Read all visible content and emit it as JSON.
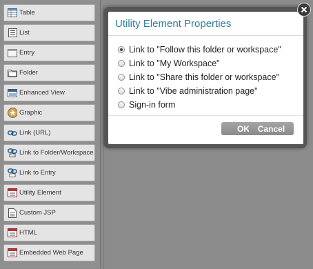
{
  "palette": {
    "items": [
      {
        "label": "Table",
        "icon": "table-icon"
      },
      {
        "label": "List",
        "icon": "list-icon"
      },
      {
        "label": "Entry",
        "icon": "entry-icon"
      },
      {
        "label": "Folder",
        "icon": "folder-icon"
      },
      {
        "label": "Enhanced View",
        "icon": "enhanced-view-icon"
      },
      {
        "label": "Graphic",
        "icon": "graphic-icon"
      },
      {
        "label": "Link (URL)",
        "icon": "link-icon"
      },
      {
        "label": "Link to Folder/Workspace",
        "icon": "link-icon"
      },
      {
        "label": "Link to Entry",
        "icon": "link-icon"
      },
      {
        "label": "Utility Element",
        "icon": "utility-element-icon"
      },
      {
        "label": "Custom JSP",
        "icon": "custom-jsp-icon"
      },
      {
        "label": "HTML",
        "icon": "html-icon"
      },
      {
        "label": "Embedded Web Page",
        "icon": "embedded-web-page-icon"
      }
    ]
  },
  "dialog": {
    "title": "Utility Element Properties",
    "options": [
      {
        "label": "Link to \"Follow this folder or workspace\"",
        "selected": true
      },
      {
        "label": "Link to \"My Workspace\"",
        "selected": false
      },
      {
        "label": "Link to \"Share this folder or workspace\"",
        "selected": false
      },
      {
        "label": "Link to \"Vibe administration page\"",
        "selected": false
      },
      {
        "label": "Sign-in form",
        "selected": false
      }
    ],
    "ok_label": "OK",
    "cancel_label": "Cancel"
  },
  "colors": {
    "title": "#2f7c9d",
    "button": "#999999",
    "backdrop": "#8c8c8c"
  }
}
